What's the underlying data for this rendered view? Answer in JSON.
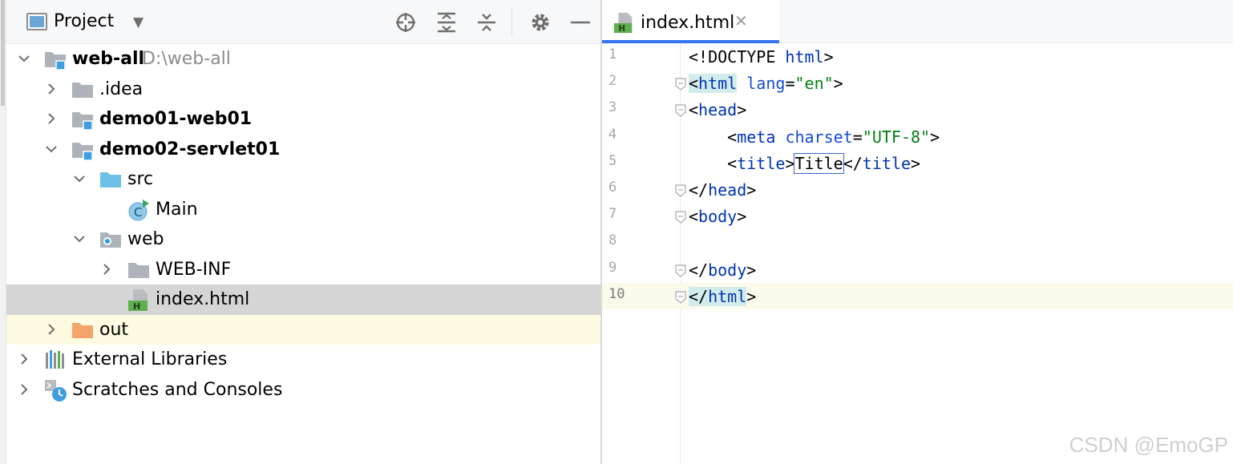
{
  "project_panel": {
    "title": "Project",
    "toolbar_icons": [
      "locate-icon",
      "expand-all-icon",
      "collapse-all-icon",
      "gear-icon",
      "minimize-icon"
    ],
    "tree": [
      {
        "label": "web-all",
        "path": "D:\\web-all",
        "bold": true,
        "expanded": true,
        "icon": "module-folder-icon"
      },
      {
        "label": ".idea",
        "expanded": false,
        "icon": "folder-icon"
      },
      {
        "label": "demo01-web01",
        "bold": true,
        "expanded": false,
        "icon": "module-folder-icon"
      },
      {
        "label": "demo02-servlet01",
        "bold": true,
        "expanded": true,
        "icon": "module-folder-icon"
      },
      {
        "label": "src",
        "expanded": true,
        "icon": "source-folder-icon"
      },
      {
        "label": "Main",
        "icon": "java-class-run-icon"
      },
      {
        "label": "web",
        "expanded": true,
        "icon": "web-folder-icon"
      },
      {
        "label": "WEB-INF",
        "expanded": false,
        "icon": "folder-icon"
      },
      {
        "label": "index.html",
        "icon": "html-file-icon",
        "selected": true
      },
      {
        "label": "out",
        "expanded": false,
        "icon": "excluded-folder-icon",
        "highlighted": true
      },
      {
        "label": "External Libraries",
        "expanded": false,
        "icon": "libraries-icon"
      },
      {
        "label": "Scratches and Consoles",
        "expanded": false,
        "icon": "scratches-icon"
      }
    ]
  },
  "editor": {
    "tab": {
      "label": "index.html",
      "close": "✕"
    },
    "lines": [
      {
        "num": "1",
        "tokens": [
          [
            "p",
            "<!DOCTYPE "
          ],
          [
            "t",
            "html"
          ],
          [
            "p",
            ">"
          ]
        ]
      },
      {
        "num": "2",
        "tokens": [
          [
            "p",
            "<"
          ],
          [
            "t",
            "html"
          ],
          [
            "p",
            " "
          ],
          [
            "a",
            "lang"
          ],
          [
            "p",
            "="
          ],
          [
            "v",
            "\"en\""
          ],
          [
            "p",
            ">"
          ]
        ]
      },
      {
        "num": "3",
        "tokens": [
          [
            "p",
            "<"
          ],
          [
            "t",
            "head"
          ],
          [
            "p",
            ">"
          ]
        ]
      },
      {
        "num": "4",
        "tokens": [
          [
            "p",
            "    <"
          ],
          [
            "t",
            "meta"
          ],
          [
            "p",
            " "
          ],
          [
            "a",
            "charset"
          ],
          [
            "p",
            "="
          ],
          [
            "v",
            "\"UTF-8\""
          ],
          [
            "p",
            ">"
          ]
        ]
      },
      {
        "num": "5",
        "tokens": [
          [
            "p",
            "    <"
          ],
          [
            "t",
            "title"
          ],
          [
            "p",
            ">Title</"
          ],
          [
            "t",
            "title"
          ],
          [
            "p",
            ">"
          ]
        ]
      },
      {
        "num": "6",
        "tokens": [
          [
            "p",
            "</"
          ],
          [
            "t",
            "head"
          ],
          [
            "p",
            ">"
          ]
        ]
      },
      {
        "num": "7",
        "tokens": [
          [
            "p",
            "<"
          ],
          [
            "t",
            "body"
          ],
          [
            "p",
            ">"
          ]
        ]
      },
      {
        "num": "8",
        "tokens": []
      },
      {
        "num": "9",
        "tokens": [
          [
            "p",
            "</"
          ],
          [
            "t",
            "body"
          ],
          [
            "p",
            ">"
          ]
        ]
      },
      {
        "num": "10",
        "tokens": [
          [
            "p",
            "</"
          ],
          [
            "t",
            "html"
          ],
          [
            "p",
            ">"
          ]
        ]
      }
    ],
    "watermark": "CSDN @EmoGP"
  },
  "colors": {
    "accent": "#3574f0",
    "selection": "#d5d5d5",
    "excluded_row": "#fefbe2",
    "tag": "#0033b3",
    "attr": "#174ad4",
    "string": "#067d17"
  }
}
